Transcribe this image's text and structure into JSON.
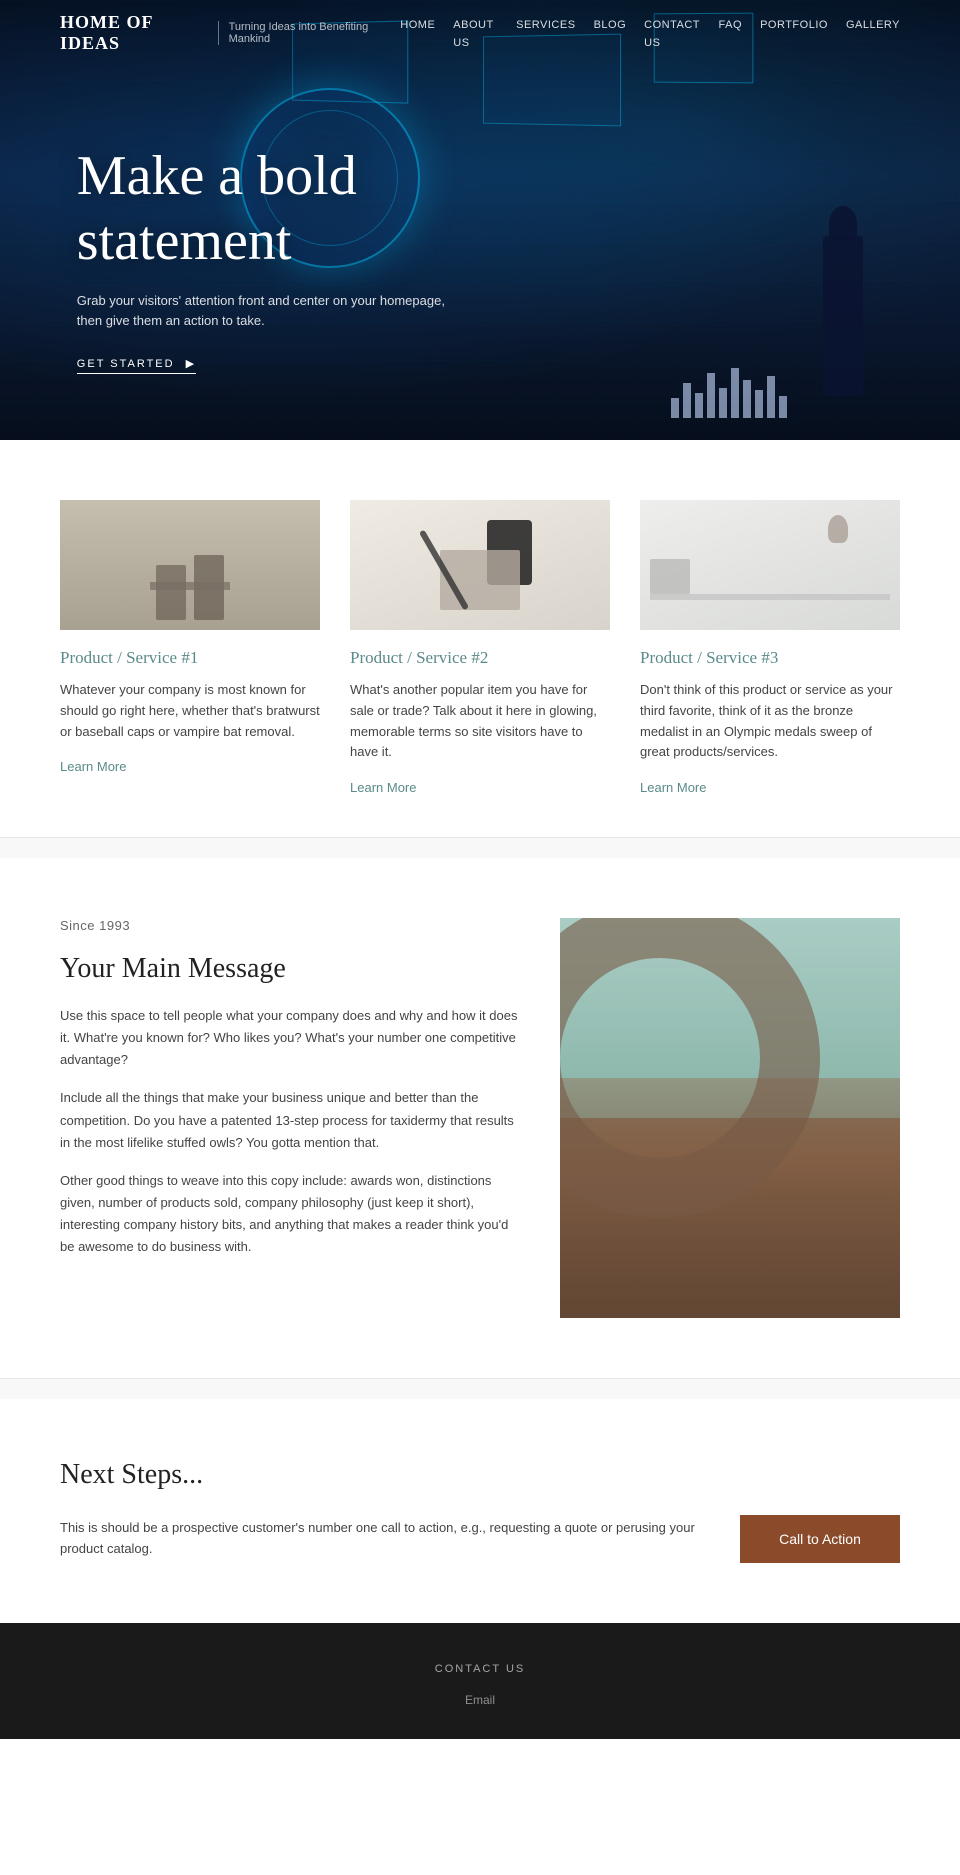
{
  "brand": {
    "logo": "HOME OF IDEAS",
    "separator": "|",
    "tagline": "Turning Ideas into Benefiting Mankind"
  },
  "nav": {
    "items": [
      {
        "label": "HOME",
        "href": "#"
      },
      {
        "label": "ABOUT US",
        "href": "#"
      },
      {
        "label": "SERVICES",
        "href": "#"
      },
      {
        "label": "BLOG",
        "href": "#"
      },
      {
        "label": "CONTACT US",
        "href": "#"
      },
      {
        "label": "FAQ",
        "href": "#"
      },
      {
        "label": "PORTFOLIO",
        "href": "#"
      },
      {
        "label": "GALLERY",
        "href": "#"
      }
    ]
  },
  "hero": {
    "headline_line1": "Make a bold",
    "headline_line2": "statement",
    "subtext": "Grab your visitors' attention front and center on your homepage, then give them an action to take.",
    "cta_label": "GET STARTED",
    "cta_arrow": "▶"
  },
  "services": {
    "items": [
      {
        "id": 1,
        "title": "Product / Service #1",
        "description": "Whatever your company is most known for should go right here, whether that's bratwurst or baseball caps or vampire bat removal.",
        "link_label": "Learn More"
      },
      {
        "id": 2,
        "title": "Product / Service #2",
        "description": "What's another popular item you have for sale or trade? Talk about it here in glowing, memorable terms so site visitors have to have it.",
        "link_label": "Learn More"
      },
      {
        "id": 3,
        "title": "Product / Service #3",
        "description": "Don't think of this product or service as your third favorite, think of it as the bronze medalist in an Olympic medals sweep of great products/services.",
        "link_label": "Learn More"
      }
    ]
  },
  "about": {
    "since_label": "Since 1993",
    "heading": "Your Main Message",
    "paragraphs": [
      "Use this space to tell people what your company does and why and how it does it. What're you known for? Who likes you? What's your number one competitive advantage?",
      "Include all the things that make your business unique and better than the competition. Do you have a patented 13-step process for taxidermy that results in the most lifelike stuffed owls? You gotta mention that.",
      "Other good things to weave into this copy include: awards won, distinctions given, number of products sold, company philosophy (just keep it short), interesting company history bits, and anything that makes a reader think you'd be awesome to do business with."
    ]
  },
  "next_steps": {
    "heading": "Next Steps...",
    "text": "This is should be a prospective customer's number one call to action, e.g., requesting a quote or perusing your product catalog.",
    "cta_label": "Call to Action"
  },
  "footer": {
    "contact_label": "CONTACT US",
    "email_label": "Email"
  }
}
